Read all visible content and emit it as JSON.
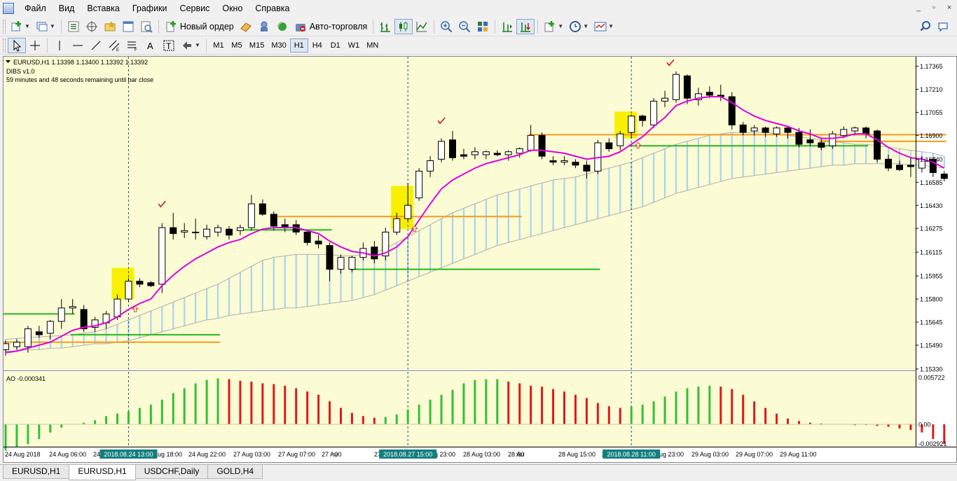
{
  "menu": {
    "items": [
      "Файл",
      "Вид",
      "Вставка",
      "Графики",
      "Сервис",
      "Окно",
      "Справка"
    ],
    "window_controls": [
      "_",
      "▫",
      "×"
    ]
  },
  "toolbar1": {
    "new_order_label": "Новый ордер",
    "auto_trading_label": "Авто-торговля"
  },
  "toolbar2": {
    "timeframes": [
      "M1",
      "M5",
      "M15",
      "M30",
      "H1",
      "H4",
      "D1",
      "W1",
      "MN"
    ],
    "active_timeframe": "H1"
  },
  "chart": {
    "header_line1": "EURUSD,H1  1.13398 1.13400 1.13392 1.13392",
    "header_line2": "DIBS v1.0",
    "header_line3": "59 minutes and 48 seconds remaining until bar close",
    "ao_label": "AO -0.000341",
    "background": "#fbfbd4",
    "bull_candle": "#ffffff",
    "bear_candle": "#000000",
    "ma_color": "#e000e0",
    "cloud_color": "#a8d4f0",
    "green_level_color": "#22b822",
    "orange_level_color": "#f39a22",
    "ao_up_color": "#33c033",
    "ao_down_color": "#e01818",
    "price_ticks": [
      "1.17365",
      "1.17210",
      "1.17055",
      "1.16900",
      "1.16740",
      "1.16585",
      "1.16430",
      "1.16275",
      "1.16115",
      "1.15955",
      "1.15800",
      "1.15645",
      "1.15490",
      "1.15330"
    ],
    "ao_ticks": [
      "0.005722",
      "0.00",
      "-0.002921"
    ],
    "time_labels": [
      "24 Aug 2018",
      "24 Aug 06:00",
      "24",
      "g 14:00",
      "24 Aug 18:00",
      "24 Aug 22:00",
      "27 Aug 03:00",
      "27 Aug 07:00",
      "27 Au",
      ":00",
      "27 Aug 19:00",
      "27 Aug 23:00",
      "28 Aug 03:00",
      "28 Au",
      ":00",
      "28 Aug 15:00",
      "28 Aug 19:00",
      "28 Aug 23:00",
      "29 Aug 03:00",
      "29 Aug 07:00",
      "29 Aug 11:00"
    ],
    "highlight_times": [
      "2018.08.24 13:00",
      "2018.08.27 15:00",
      "2018.08.28 11:00"
    ]
  },
  "chart_data": {
    "type": "candlestick",
    "symbol": "EURUSD",
    "timeframe": "H1",
    "ylim": [
      1.1533,
      1.1741
    ],
    "candles": [
      [
        1.1546,
        1.1552,
        1.1542,
        1.155
      ],
      [
        1.1548,
        1.1553,
        1.1546,
        1.1551
      ],
      [
        1.1548,
        1.1562,
        1.1544,
        1.156
      ],
      [
        1.1558,
        1.1562,
        1.1554,
        1.1556
      ],
      [
        1.1557,
        1.1566,
        1.1553,
        1.1565
      ],
      [
        1.1565,
        1.158,
        1.156,
        1.1574
      ],
      [
        1.1574,
        1.158,
        1.157,
        1.1575
      ],
      [
        1.1573,
        1.1576,
        1.1558,
        1.156
      ],
      [
        1.1561,
        1.1568,
        1.1558,
        1.1566
      ],
      [
        1.1564,
        1.1572,
        1.156,
        1.157
      ],
      [
        1.1568,
        1.1583,
        1.1566,
        1.158
      ],
      [
        1.158,
        1.1594,
        1.1578,
        1.1592
      ],
      [
        1.1592,
        1.1594,
        1.1588,
        1.159
      ],
      [
        1.1591,
        1.1592,
        1.1588,
        1.1589
      ],
      [
        1.159,
        1.1631,
        1.1584,
        1.1628
      ],
      [
        1.1628,
        1.1638,
        1.162,
        1.1624
      ],
      [
        1.1625,
        1.1631,
        1.1621,
        1.1626
      ],
      [
        1.1625,
        1.1634,
        1.162,
        1.1625
      ],
      [
        1.1622,
        1.163,
        1.162,
        1.1627
      ],
      [
        1.1625,
        1.163,
        1.1622,
        1.1628
      ],
      [
        1.1627,
        1.1629,
        1.162,
        1.1623
      ],
      [
        1.1626,
        1.163,
        1.1623,
        1.1628
      ],
      [
        1.1628,
        1.165,
        1.1626,
        1.1644
      ],
      [
        1.1644,
        1.1647,
        1.1636,
        1.1637
      ],
      [
        1.1637,
        1.1639,
        1.1626,
        1.1629
      ],
      [
        1.163,
        1.1634,
        1.1625,
        1.1628
      ],
      [
        1.163,
        1.1633,
        1.1623,
        1.1625
      ],
      [
        1.1625,
        1.1626,
        1.1616,
        1.1618
      ],
      [
        1.1619,
        1.1623,
        1.1614,
        1.1617
      ],
      [
        1.1616,
        1.1618,
        1.1592,
        1.16
      ],
      [
        1.16,
        1.161,
        1.1597,
        1.1608
      ],
      [
        1.16,
        1.1609,
        1.1598,
        1.1608
      ],
      [
        1.1608,
        1.1618,
        1.1606,
        1.1614
      ],
      [
        1.1615,
        1.1619,
        1.1604,
        1.1607
      ],
      [
        1.1609,
        1.1628,
        1.1606,
        1.1625
      ],
      [
        1.1625,
        1.1638,
        1.1623,
        1.1634
      ],
      [
        1.1634,
        1.1658,
        1.1632,
        1.1643
      ],
      [
        1.1648,
        1.1668,
        1.1646,
        1.1666
      ],
      [
        1.1666,
        1.1676,
        1.1662,
        1.1673
      ],
      [
        1.1674,
        1.1688,
        1.1672,
        1.1686
      ],
      [
        1.1687,
        1.1693,
        1.1673,
        1.1675
      ],
      [
        1.1677,
        1.1681,
        1.1674,
        1.1676
      ],
      [
        1.1677,
        1.1682,
        1.1674,
        1.1679
      ],
      [
        1.1677,
        1.168,
        1.1674,
        1.1679
      ],
      [
        1.1678,
        1.168,
        1.1676,
        1.1677
      ],
      [
        1.1677,
        1.168,
        1.1673,
        1.1679
      ],
      [
        1.1678,
        1.1682,
        1.1675,
        1.1681
      ],
      [
        1.168,
        1.1697,
        1.1679,
        1.169
      ],
      [
        1.169,
        1.1692,
        1.1674,
        1.1676
      ],
      [
        1.1673,
        1.1676,
        1.167,
        1.1672
      ],
      [
        1.1672,
        1.1676,
        1.167,
        1.1673
      ],
      [
        1.1672,
        1.1674,
        1.1668,
        1.167
      ],
      [
        1.167,
        1.1673,
        1.1661,
        1.1666
      ],
      [
        1.1666,
        1.1687,
        1.1664,
        1.1685
      ],
      [
        1.1685,
        1.1688,
        1.1679,
        1.1681
      ],
      [
        1.1683,
        1.1693,
        1.168,
        1.1691
      ],
      [
        1.1692,
        1.1704,
        1.1688,
        1.1703
      ],
      [
        1.1703,
        1.1704,
        1.1696,
        1.17
      ],
      [
        1.1697,
        1.1715,
        1.1695,
        1.1713
      ],
      [
        1.1713,
        1.172,
        1.1709,
        1.1715
      ],
      [
        1.1714,
        1.1733,
        1.1712,
        1.1731
      ],
      [
        1.173,
        1.1731,
        1.1711,
        1.1715
      ],
      [
        1.1714,
        1.1722,
        1.171,
        1.1718
      ],
      [
        1.1719,
        1.1723,
        1.1715,
        1.1717
      ],
      [
        1.1717,
        1.1724,
        1.1713,
        1.1716
      ],
      [
        1.1716,
        1.1719,
        1.1694,
        1.1697
      ],
      [
        1.1697,
        1.1699,
        1.169,
        1.1692
      ],
      [
        1.1693,
        1.1697,
        1.169,
        1.1695
      ],
      [
        1.1695,
        1.1696,
        1.1689,
        1.1692
      ],
      [
        1.1691,
        1.1696,
        1.1689,
        1.1695
      ],
      [
        1.1695,
        1.1696,
        1.1688,
        1.1692
      ],
      [
        1.1692,
        1.1695,
        1.1682,
        1.1684
      ],
      [
        1.1687,
        1.1694,
        1.1683,
        1.1685
      ],
      [
        1.1685,
        1.1688,
        1.168,
        1.1682
      ],
      [
        1.1683,
        1.1693,
        1.1681,
        1.1691
      ],
      [
        1.169,
        1.1696,
        1.1688,
        1.1694
      ],
      [
        1.1693,
        1.1696,
        1.169,
        1.1695
      ],
      [
        1.1695,
        1.1696,
        1.1688,
        1.1691
      ],
      [
        1.1693,
        1.1694,
        1.1672,
        1.1674
      ],
      [
        1.1674,
        1.1677,
        1.1666,
        1.1668
      ],
      [
        1.167,
        1.1673,
        1.1666,
        1.1667
      ],
      [
        1.167,
        1.1675,
        1.1662,
        1.1669
      ],
      [
        1.1668,
        1.1676,
        1.1665,
        1.1674
      ],
      [
        1.1674,
        1.1675,
        1.1662,
        1.1665
      ],
      [
        1.1664,
        1.1666,
        1.1659,
        1.1661
      ]
    ],
    "ao_values": [
      -0.0032,
      -0.0028,
      -0.0024,
      -0.0018,
      -0.001,
      -0.0004,
      0.0,
      0.0002,
      0.0005,
      0.001,
      0.0013,
      0.0016,
      0.002,
      0.0024,
      0.003,
      0.0038,
      0.0044,
      0.005,
      0.0054,
      0.0056,
      0.0055,
      0.0053,
      0.0052,
      0.005,
      0.0049,
      0.0047,
      0.0044,
      0.004,
      0.0036,
      0.0028,
      0.002,
      0.0014,
      0.001,
      0.0008,
      0.0009,
      0.0012,
      0.0018,
      0.0024,
      0.003,
      0.0036,
      0.0042,
      0.005,
      0.0054,
      0.0055,
      0.0055,
      0.0052,
      0.005,
      0.0047,
      0.0046,
      0.0043,
      0.004,
      0.0036,
      0.0032,
      0.0026,
      0.0022,
      0.002,
      0.0022,
      0.0024,
      0.0028,
      0.0034,
      0.004,
      0.0044,
      0.0046,
      0.0047,
      0.0046,
      0.0043,
      0.0036,
      0.0028,
      0.002,
      0.0013,
      0.0007,
      0.0004,
      0.0002,
      0.0001,
      0.0,
      0.0,
      -0.0001,
      -0.0001,
      -0.0002,
      -0.0003,
      -0.0005,
      -0.0007,
      -0.001,
      -0.0018,
      -0.0024
    ],
    "ma_values": [
      1.1544,
      1.1545,
      1.1547,
      1.1549,
      1.1551,
      1.1555,
      1.1559,
      1.1561,
      1.1562,
      1.1564,
      1.1568,
      1.1573,
      1.1577,
      1.158,
      1.1589,
      1.1596,
      1.1602,
      1.1607,
      1.1611,
      1.1615,
      1.1618,
      1.162,
      1.1624,
      1.1627,
      1.1628,
      1.1628,
      1.1628,
      1.1626,
      1.1624,
      1.1619,
      1.1615,
      1.1612,
      1.1611,
      1.1609,
      1.1611,
      1.1615,
      1.1622,
      1.1633,
      1.1644,
      1.1654,
      1.166,
      1.1664,
      1.1668,
      1.1671,
      1.1673,
      1.1675,
      1.1677,
      1.168,
      1.168,
      1.1679,
      1.1678,
      1.1676,
      1.1674,
      1.1675,
      1.1676,
      1.1679,
      1.1684,
      1.1689,
      1.1696,
      1.1702,
      1.171,
      1.1713,
      1.1715,
      1.1716,
      1.1716,
      1.1712,
      1.1707,
      1.1703,
      1.17,
      1.1698,
      1.1696,
      1.1693,
      1.1691,
      1.1688,
      1.1688,
      1.1689,
      1.1691,
      1.1691,
      1.1687,
      1.1682,
      1.1678,
      1.1675,
      1.1674,
      1.1672,
      1.1668
    ],
    "cloud_upper": [
      1.1553,
      1.15535,
      1.1554,
      1.15545,
      1.1555,
      1.15555,
      1.1556,
      1.1557,
      1.1558,
      1.156,
      1.1563,
      1.1566,
      1.1569,
      1.1572,
      1.1575,
      1.1578,
      1.1581,
      1.1584,
      1.1587,
      1.159,
      1.1594,
      1.1598,
      1.1602,
      1.1606,
      1.1608,
      1.1609,
      1.161,
      1.161,
      1.161,
      1.161,
      1.1609,
      1.1609,
      1.161,
      1.1611,
      1.1614,
      1.1618,
      1.1622,
      1.1626,
      1.163,
      1.1634,
      1.1638,
      1.1641,
      1.1644,
      1.1647,
      1.165,
      1.1652,
      1.1654,
      1.1656,
      1.1658,
      1.166,
      1.1661,
      1.1662,
      1.1664,
      1.1666,
      1.1668,
      1.167,
      1.1672,
      1.1675,
      1.1678,
      1.1681,
      1.1684,
      1.1686,
      1.1688,
      1.169,
      1.1691,
      1.1692,
      1.1692,
      1.1692,
      1.1692,
      1.1691,
      1.169,
      1.1689,
      1.1688,
      1.1687,
      1.1686,
      1.1685,
      1.1684,
      1.1684,
      1.1683,
      1.1682,
      1.1681,
      1.168,
      1.1679,
      1.1678,
      1.1676
    ],
    "cloud_lower": [
      1.1545,
      1.1545,
      1.1546,
      1.1546,
      1.1547,
      1.1547,
      1.1548,
      1.1549,
      1.155,
      1.155,
      1.1551,
      1.1552,
      1.1554,
      1.1556,
      1.1558,
      1.156,
      1.1562,
      1.1564,
      1.1566,
      1.1567,
      1.1569,
      1.157,
      1.1571,
      1.1572,
      1.1573,
      1.1574,
      1.1574,
      1.1575,
      1.1576,
      1.1577,
      1.1578,
      1.1579,
      1.1581,
      1.1583,
      1.1586,
      1.1589,
      1.1592,
      1.1595,
      1.1598,
      1.1601,
      1.1604,
      1.1607,
      1.161,
      1.1613,
      1.1616,
      1.1618,
      1.162,
      1.1622,
      1.1624,
      1.1626,
      1.1628,
      1.163,
      1.1632,
      1.1634,
      1.1636,
      1.1638,
      1.164,
      1.1642,
      1.1645,
      1.1648,
      1.1651,
      1.1653,
      1.1655,
      1.1657,
      1.1659,
      1.1661,
      1.1662,
      1.1663,
      1.1664,
      1.1665,
      1.1666,
      1.1667,
      1.1668,
      1.1669,
      1.167,
      1.167,
      1.1671,
      1.1671,
      1.1671,
      1.1671,
      1.1671,
      1.167,
      1.167,
      1.1669,
      1.1668
    ],
    "levels": [
      {
        "color": "green",
        "price": 1.157,
        "from": 0,
        "to": 6
      },
      {
        "color": "green",
        "price": 1.1556,
        "from": 6,
        "to": 19
      },
      {
        "color": "orange",
        "price": 1.1551,
        "from": 0,
        "to": 19
      },
      {
        "color": "green",
        "price": 1.16265,
        "from": 21,
        "to": 29
      },
      {
        "color": "orange",
        "price": 1.16355,
        "from": 24,
        "to": 46
      },
      {
        "color": "green",
        "price": 1.16,
        "from": 31,
        "to": 53
      },
      {
        "color": "orange",
        "price": 1.16905,
        "from": 47,
        "to": 84
      },
      {
        "color": "green",
        "price": 1.1683,
        "from": 56,
        "to": 77
      },
      {
        "color": "orange",
        "price": 1.1686,
        "from": 73,
        "to": 84
      }
    ],
    "highlight_zones": [
      {
        "from": 10,
        "to": 11,
        "low": 1.158,
        "high": 1.1601
      },
      {
        "from": 35,
        "to": 36,
        "low": 1.1627,
        "high": 1.1656
      },
      {
        "from": 55,
        "to": 56,
        "low": 1.1688,
        "high": 1.1706
      }
    ],
    "arrows": [
      11.6,
      36.6,
      56.6
    ],
    "checkmarks": [
      {
        "i": 14,
        "price": 1.1643
      },
      {
        "i": 39,
        "price": 1.1699
      },
      {
        "i": 59.5,
        "price": 1.1738
      }
    ],
    "vlines": [
      11,
      36,
      56
    ]
  },
  "tabs": {
    "items": [
      "EURUSD,H1",
      "EURUSD,H1",
      "USDCHF,Daily",
      "GOLD,H4"
    ],
    "active_index": 1
  }
}
